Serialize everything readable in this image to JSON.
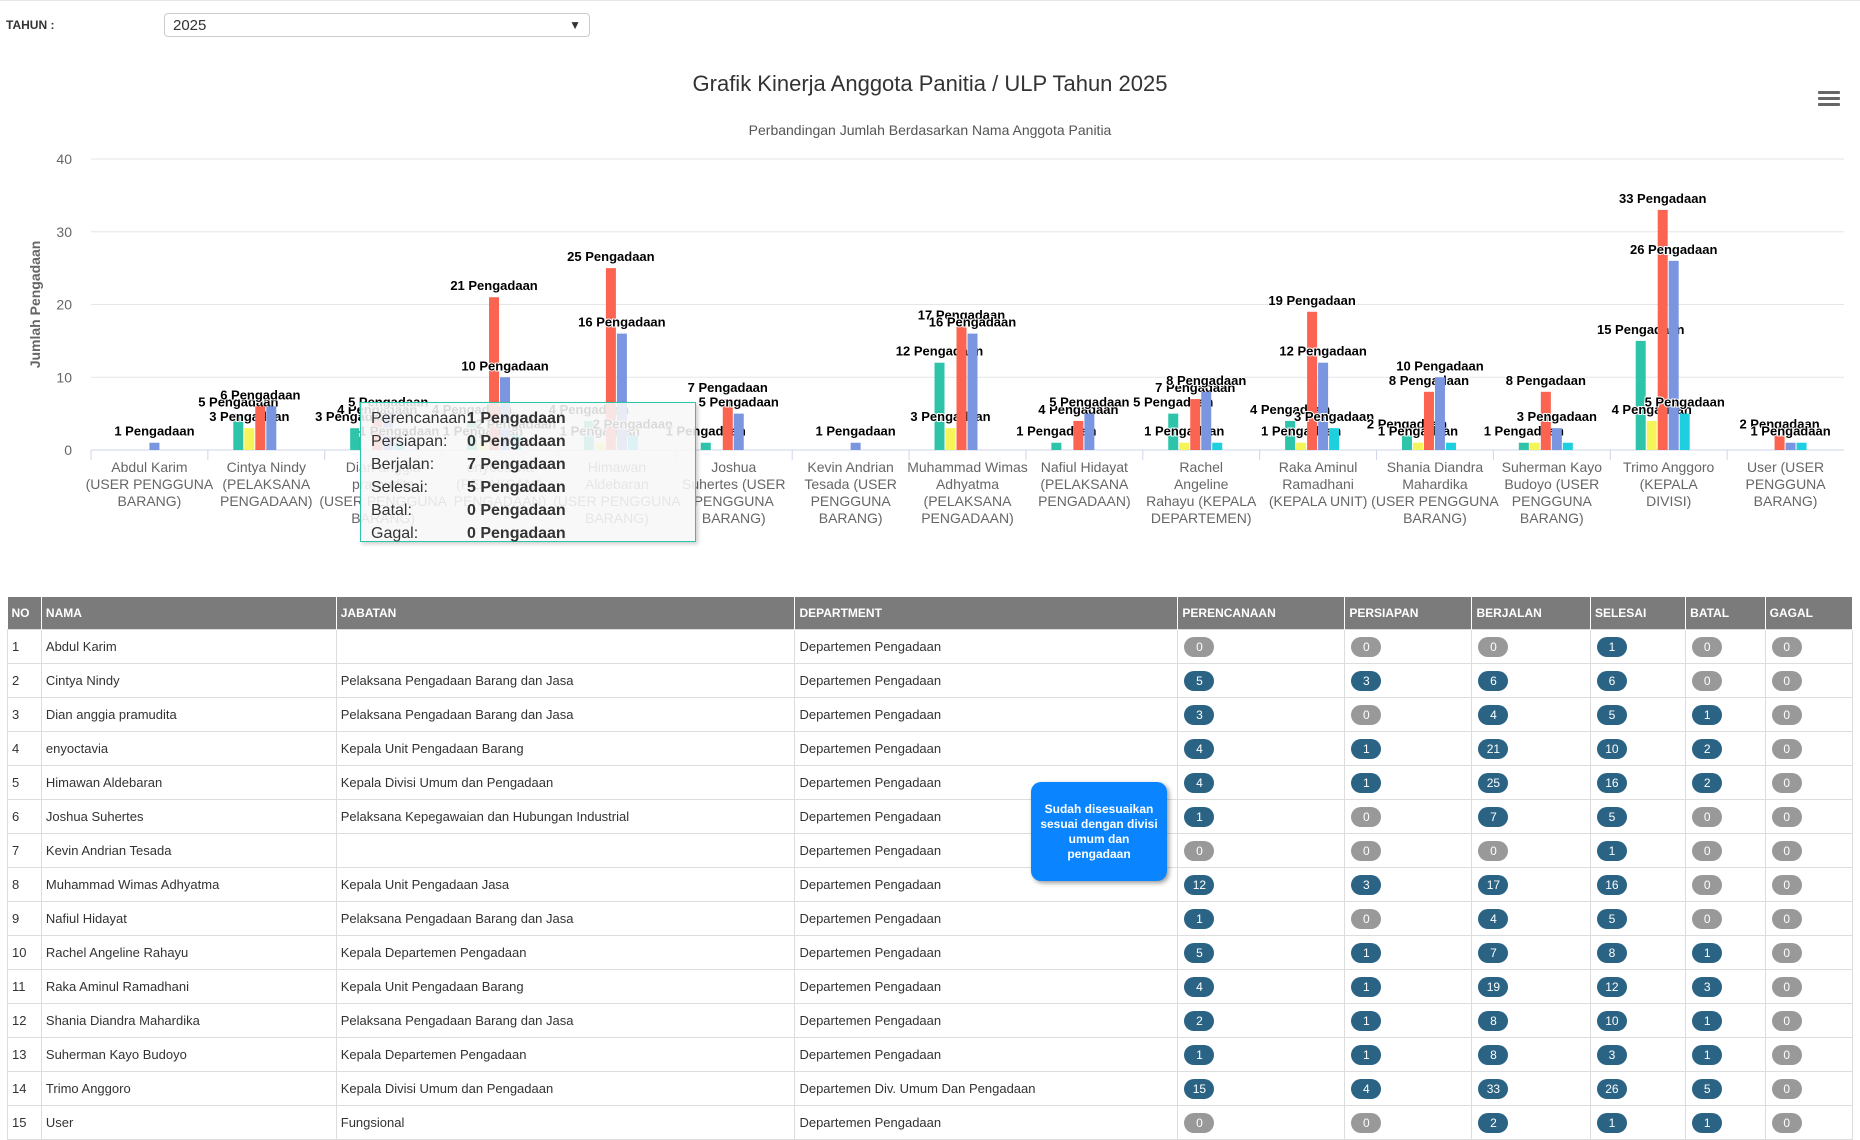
{
  "filter": {
    "label": "TAHUN :",
    "year": "2025"
  },
  "chart_data": {
    "type": "bar",
    "title": "Grafik Kinerja Anggota Panitia / ULP Tahun 2025",
    "subtitle": "Perbandingan Jumlah Berdasarkan Nama Anggota Panitia",
    "ylabel": "Jumlah Pengadaan",
    "xlabel": "",
    "ylim": [
      0,
      40
    ],
    "yticks": [
      0,
      10,
      20,
      30,
      40
    ],
    "grid": true,
    "label_suffix": " Pengadaan",
    "categories": [
      "Abdul Karim (USER PENGGUNA BARANG)",
      "Cintya Nindy (PELAKSANA PENGADAAN)",
      "Dian anggia pramudita (USER PENGGUNA BARANG)",
      "enyoctavia (PELAKSANA PENGADAAN)",
      "Himawan Aldebaran (USER PENGGUNA BARANG)",
      "Joshua Suhertes (USER PENGGUNA BARANG)",
      "Kevin Andrian Tesada (USER PENGGUNA BARANG)",
      "Muhammad Wimas Adhyatma (PELAKSANA PENGADAAN)",
      "Nafiul Hidayat (PELAKSANA PENGADAAN)",
      "Rachel Angeline Rahayu (KEPALA DEPARTEMEN)",
      "Raka Aminul Ramadhani (KEPALA UNIT)",
      "Shania Diandra Mahardika (USER PENGGUNA BARANG)",
      "Suherman Kayo Budoyo (USER PENGGUNA BARANG)",
      "Trimo Anggoro (KEPALA DIVISI)",
      "User (USER PENGGUNA BARANG)"
    ],
    "series": [
      {
        "name": "Perencanaan",
        "color": "#2ec4a9",
        "values": [
          0,
          5,
          3,
          4,
          4,
          1,
          0,
          12,
          1,
          5,
          4,
          2,
          1,
          15,
          0
        ]
      },
      {
        "name": "Persiapan",
        "color": "#f5f55a",
        "values": [
          0,
          3,
          0,
          1,
          1,
          0,
          0,
          3,
          0,
          1,
          1,
          1,
          1,
          4,
          0
        ]
      },
      {
        "name": "Berjalan",
        "color": "#fa6450",
        "values": [
          0,
          6,
          4,
          21,
          25,
          7,
          0,
          17,
          4,
          7,
          19,
          8,
          8,
          33,
          2
        ]
      },
      {
        "name": "Selesai",
        "color": "#7b96e0",
        "values": [
          1,
          6,
          5,
          10,
          16,
          5,
          1,
          16,
          5,
          8,
          12,
          10,
          3,
          26,
          1
        ]
      },
      {
        "name": "Batal",
        "color": "#1ecfe0",
        "values": [
          0,
          0,
          1,
          2,
          2,
          0,
          0,
          0,
          0,
          1,
          3,
          1,
          1,
          5,
          1
        ]
      },
      {
        "name": "Gagal",
        "color": "#9b6fd6",
        "values": [
          0,
          0,
          0,
          0,
          0,
          0,
          0,
          0,
          0,
          0,
          0,
          0,
          0,
          0,
          0
        ]
      }
    ],
    "tooltip": {
      "rows": [
        {
          "k": "Perencanaan:",
          "v": "1 Pengadaan"
        },
        {
          "k": "Persiapan:",
          "v": "0 Pengadaan"
        },
        {
          "k": "Berjalan:",
          "v": "7 Pengadaan"
        },
        {
          "k": "Selesai:",
          "v": "5 Pengadaan"
        },
        {
          "k": "Batal:",
          "v": "0 Pengadaan"
        },
        {
          "k": "Gagal:",
          "v": "0 Pengadaan"
        }
      ]
    }
  },
  "table": {
    "headers": [
      "NO",
      "NAMA",
      "JABATAN",
      "DEPARTMENT",
      "PERENCANAAN",
      "PERSIAPAN",
      "BERJALAN",
      "SELESAI",
      "BATAL",
      "GAGAL"
    ],
    "rows": [
      [
        "1",
        "Abdul Karim",
        "",
        "Departemen Pengadaan",
        "0",
        "0",
        "0",
        "1",
        "0",
        "0"
      ],
      [
        "2",
        "Cintya Nindy",
        "Pelaksana Pengadaan Barang dan Jasa",
        "Departemen Pengadaan",
        "5",
        "3",
        "6",
        "6",
        "0",
        "0"
      ],
      [
        "3",
        "Dian anggia pramudita",
        "Pelaksana Pengadaan Barang dan Jasa",
        "Departemen Pengadaan",
        "3",
        "0",
        "4",
        "5",
        "1",
        "0"
      ],
      [
        "4",
        "enyoctavia",
        "Kepala Unit Pengadaan Barang",
        "Departemen Pengadaan",
        "4",
        "1",
        "21",
        "10",
        "2",
        "0"
      ],
      [
        "5",
        "Himawan Aldebaran",
        "Kepala Divisi Umum dan Pengadaan",
        "Departemen Pengadaan",
        "4",
        "1",
        "25",
        "16",
        "2",
        "0"
      ],
      [
        "6",
        "Joshua Suhertes",
        "Pelaksana Kepegawaian dan Hubungan Industrial",
        "Departemen Pengadaan",
        "1",
        "0",
        "7",
        "5",
        "0",
        "0"
      ],
      [
        "7",
        "Kevin Andrian Tesada",
        "",
        "Departemen Pengadaan",
        "0",
        "0",
        "0",
        "1",
        "0",
        "0"
      ],
      [
        "8",
        "Muhammad Wimas Adhyatma",
        "Kepala Unit Pengadaan Jasa",
        "Departemen Pengadaan",
        "12",
        "3",
        "17",
        "16",
        "0",
        "0"
      ],
      [
        "9",
        "Nafiul Hidayat",
        "Pelaksana Pengadaan Barang dan Jasa",
        "Departemen Pengadaan",
        "1",
        "0",
        "4",
        "5",
        "0",
        "0"
      ],
      [
        "10",
        "Rachel Angeline Rahayu",
        "Kepala Departemen Pengadaan",
        "Departemen Pengadaan",
        "5",
        "1",
        "7",
        "8",
        "1",
        "0"
      ],
      [
        "11",
        "Raka Aminul Ramadhani",
        "Kepala Unit Pengadaan Barang",
        "Departemen Pengadaan",
        "4",
        "1",
        "19",
        "12",
        "3",
        "0"
      ],
      [
        "12",
        "Shania Diandra Mahardika",
        "Pelaksana Pengadaan Barang dan Jasa",
        "Departemen Pengadaan",
        "2",
        "1",
        "8",
        "10",
        "1",
        "0"
      ],
      [
        "13",
        "Suherman Kayo Budoyo",
        "Kepala Departemen Pengadaan",
        "Departemen Pengadaan",
        "1",
        "1",
        "8",
        "3",
        "1",
        "0"
      ],
      [
        "14",
        "Trimo Anggoro",
        "Kepala Divisi Umum dan Pengadaan",
        "Departemen Div. Umum Dan Pengadaan",
        "15",
        "4",
        "33",
        "26",
        "5",
        "0"
      ],
      [
        "15",
        "User",
        "Fungsional",
        "Departemen Pengadaan",
        "0",
        "0",
        "2",
        "1",
        "1",
        "0"
      ]
    ]
  },
  "note": "Sudah disesuaikan sesuai dengan divisi umum dan pengadaan"
}
